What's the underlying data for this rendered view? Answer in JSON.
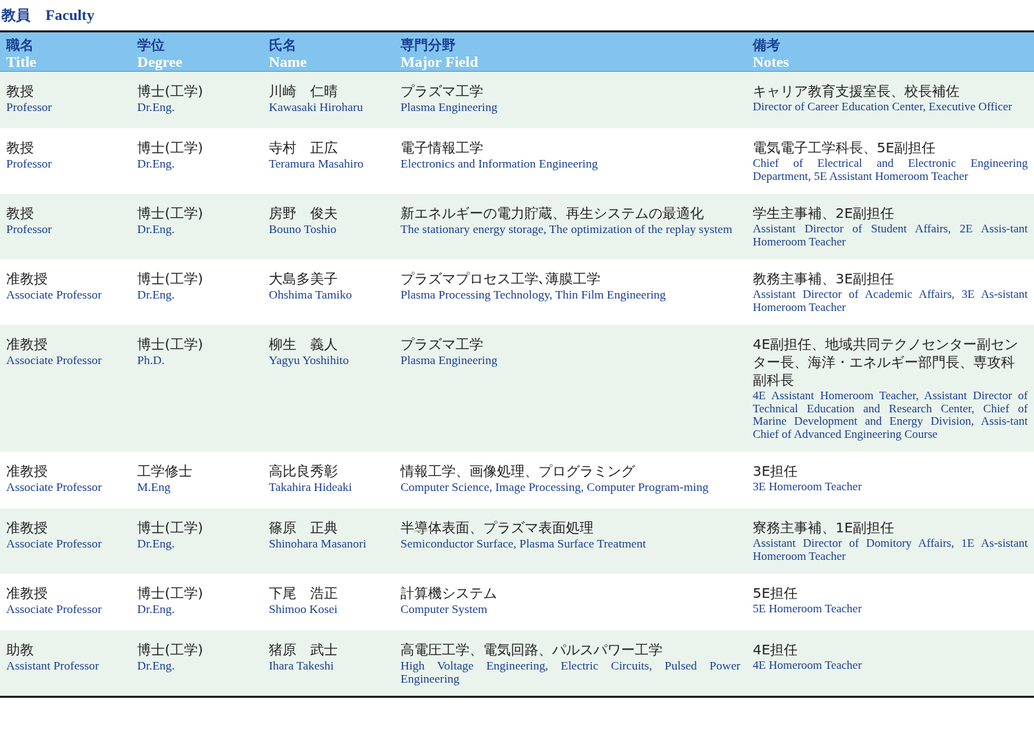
{
  "heading": {
    "jp": "教員",
    "en": "Faculty"
  },
  "columns": [
    {
      "jp": "職名",
      "en": "Title"
    },
    {
      "jp": "学位",
      "en": "Degree"
    },
    {
      "jp": "氏名",
      "en": "Name"
    },
    {
      "jp": "専門分野",
      "en": "Major Field"
    },
    {
      "jp": "備考",
      "en": "Notes"
    }
  ],
  "rows": [
    {
      "cells": [
        {
          "jp": "教授",
          "en": "Professor"
        },
        {
          "jp": "博士(工学)",
          "en": "Dr.Eng."
        },
        {
          "jp": "川崎　仁晴",
          "en": "Kawasaki Hiroharu"
        },
        {
          "jp": "プラズマ工学",
          "en": "Plasma Engineering"
        },
        {
          "jp": "キャリア教育支援室長、校長補佐",
          "en": "Director of Career Education Center, Executive Officer"
        }
      ]
    },
    {
      "cells": [
        {
          "jp": "教授",
          "en": "Professor"
        },
        {
          "jp": "博士(工学)",
          "en": "Dr.Eng."
        },
        {
          "jp": "寺村　正広",
          "en": "Teramura Masahiro"
        },
        {
          "jp": "電子情報工学",
          "en": "Electronics and Information Engineering"
        },
        {
          "jp": "電気電子工学科長、5E副担任",
          "en": "Chief of Electrical and Electronic Engineering Department, 5E Assistant Homeroom Teacher"
        }
      ]
    },
    {
      "cells": [
        {
          "jp": "教授",
          "en": "Professor"
        },
        {
          "jp": "博士(工学)",
          "en": "Dr.Eng."
        },
        {
          "jp": "房野　俊夫",
          "en": "Bouno Toshio"
        },
        {
          "jp": "新エネルギーの電力貯蔵、再生システムの最適化",
          "en": "The stationary energy storage, The optimization of the replay system"
        },
        {
          "jp": "学生主事補、2E副担任",
          "en": "Assistant Director of Student Affairs, 2E Assis-tant Homeroom Teacher"
        }
      ]
    },
    {
      "cells": [
        {
          "jp": "准教授",
          "en": "Associate Professor"
        },
        {
          "jp": "博士(工学)",
          "en": "Dr.Eng."
        },
        {
          "jp": "大島多美子",
          "en": "Ohshima Tamiko"
        },
        {
          "jp": "プラズマプロセス工学､薄膜工学",
          "en": "Plasma Processing Technology, Thin Film Engineering"
        },
        {
          "jp": "教務主事補、3E副担任",
          "en": "Assistant Director of Academic Affairs, 3E As-sistant Homeroom Teacher"
        }
      ]
    },
    {
      "cells": [
        {
          "jp": "准教授",
          "en": "Associate Professor"
        },
        {
          "jp": "博士(工学)",
          "en": "Ph.D."
        },
        {
          "jp": "柳生　義人",
          "en": "Yagyu Yoshihito"
        },
        {
          "jp": "プラズマ工学",
          "en": "Plasma Engineering"
        },
        {
          "jp": "4E副担任、地域共同テクノセンター副センター長、海洋・エネルギー部門長、専攻科副科長",
          "en": "4E Assistant Homeroom Teacher, Assistant Director of Technical Education and Research Center, Chief of Marine Development and Energy Division, Assis-tant Chief of Advanced Engineering Course"
        }
      ]
    },
    {
      "cells": [
        {
          "jp": "准教授",
          "en": "Associate Professor"
        },
        {
          "jp": "工学修士",
          "en": "M.Eng"
        },
        {
          "jp": "高比良秀彰",
          "en": "Takahira Hideaki"
        },
        {
          "jp": "情報工学、画像処理、プログラミング",
          "en": "Computer Science, Image Processing, Computer Program-ming"
        },
        {
          "jp": "3E担任",
          "en": "3E Homeroom Teacher"
        }
      ]
    },
    {
      "cells": [
        {
          "jp": "准教授",
          "en": "Associate Professor"
        },
        {
          "jp": "博士(工学)",
          "en": "Dr.Eng."
        },
        {
          "jp": "篠原　正典",
          "en": "Shinohara Masanori"
        },
        {
          "jp": "半導体表面、プラズマ表面処理",
          "en": "Semiconductor Surface, Plasma Surface Treatment"
        },
        {
          "jp": "寮務主事補、1E副担任",
          "en": "Assistant Director of Domitory Affairs, 1E As-sistant Homeroom Teacher"
        }
      ]
    },
    {
      "cells": [
        {
          "jp": "准教授",
          "en": "Associate Professor"
        },
        {
          "jp": "博士(工学)",
          "en": "Dr.Eng."
        },
        {
          "jp": "下尾　浩正",
          "en": "Shimoo Kosei"
        },
        {
          "jp": "計算機システム",
          "en": "Computer System"
        },
        {
          "jp": "5E担任",
          "en": "5E Homeroom Teacher"
        }
      ]
    },
    {
      "cells": [
        {
          "jp": "助教",
          "en": "Assistant Professor"
        },
        {
          "jp": "博士(工学)",
          "en": "Dr.Eng."
        },
        {
          "jp": "猪原　武士",
          "en": "Ihara Takeshi"
        },
        {
          "jp": "高電圧工学、電気回路、パルスパワー工学",
          "en": "High Voltage Engineering, Electric Circuits, Pulsed Power Engineering"
        },
        {
          "jp": "4E担任",
          "en": "4E Homeroom Teacher"
        }
      ]
    }
  ]
}
